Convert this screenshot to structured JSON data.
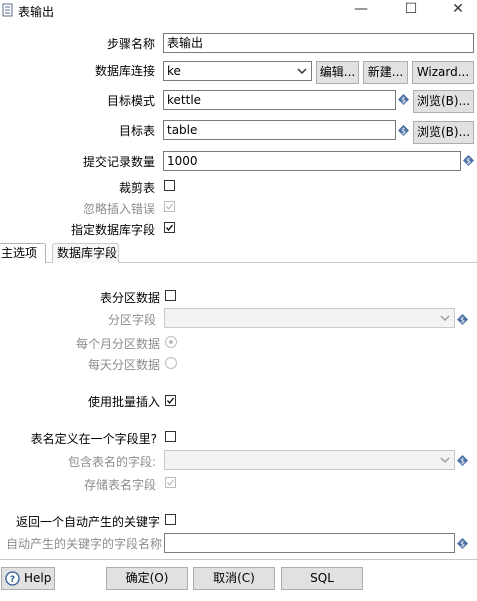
{
  "window": {
    "title": "表输出",
    "minimize_glyph": "—",
    "maximize_glyph": "☐",
    "close_glyph": "✕"
  },
  "form": {
    "step_name": {
      "label": "步骤名称",
      "value": "表输出"
    },
    "connection": {
      "label": "数据库连接",
      "value": "ke",
      "edit_btn": "编辑...",
      "new_btn": "新建...",
      "wizard_btn": "Wizard..."
    },
    "target_schema": {
      "label": "目标模式",
      "value": "kettle",
      "browse_btn": "浏览(B)..."
    },
    "target_table": {
      "label": "目标表",
      "value": "table",
      "browse_btn": "浏览(B)..."
    },
    "commit_size": {
      "label": "提交记录数量",
      "value": "1000"
    },
    "truncate": {
      "label": "裁剪表",
      "checked": false
    },
    "ignore_errors": {
      "label": "忽略插入错误",
      "checked": true,
      "enabled": false
    },
    "specify_fields": {
      "label": "指定数据库字段",
      "checked": true
    }
  },
  "tabs": [
    {
      "label": "主选项",
      "selected": true
    },
    {
      "label": "数据库字段",
      "selected": false
    }
  ],
  "main_options": {
    "partition": {
      "label": "表分区数据",
      "checked": false
    },
    "partition_field": {
      "label": "分区字段",
      "value": ""
    },
    "monthly": {
      "label": "每个月分区数据",
      "selected": true
    },
    "daily": {
      "label": "每天分区数据",
      "selected": false
    },
    "batch": {
      "label": "使用批量插入",
      "checked": true
    },
    "table_in_field": {
      "label": "表名定义在一个字段里?",
      "checked": false
    },
    "table_name_field": {
      "label": "包含表名的字段:",
      "value": ""
    },
    "store_table_name": {
      "label": "存储表名字段",
      "checked": true
    },
    "return_key": {
      "label": "返回一个自动产生的关键字",
      "checked": false
    },
    "key_field_name": {
      "label": "自动产生的关键字的字段名称",
      "value": ""
    }
  },
  "footer": {
    "help_btn": "Help",
    "ok_btn": "确定(O)",
    "cancel_btn": "取消(C)",
    "sql_btn": "SQL"
  },
  "colors": {
    "variable_icon": "#4a6fa5",
    "dialog_bg": "#ffffff",
    "button_bg": "#e1e1e1",
    "disabled_text": "#8c8c8c"
  }
}
